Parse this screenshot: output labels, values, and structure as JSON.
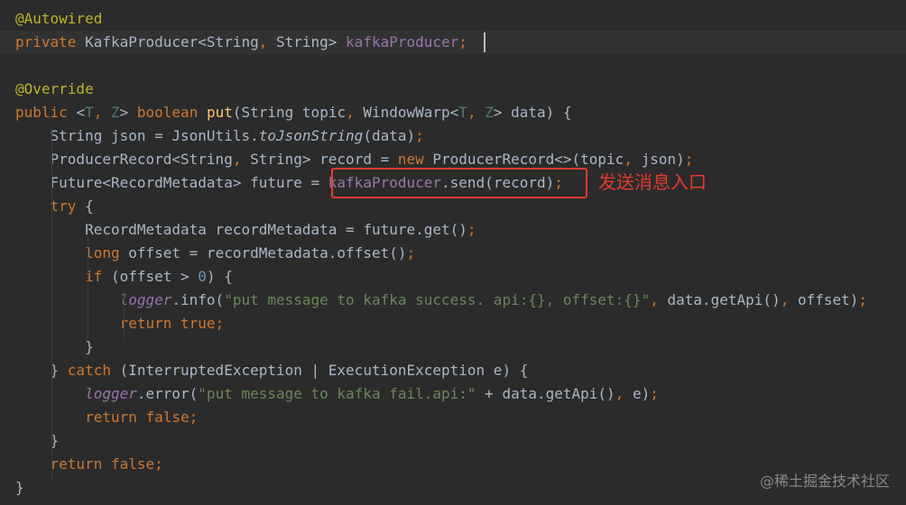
{
  "colors": {
    "background": "#2b2b2b",
    "current_line": "#323232",
    "default_text": "#a9b7c6",
    "keyword": "#cc7832",
    "annotation": "#bbb529",
    "field": "#9876aa",
    "method_declaration": "#ffc66d",
    "string": "#6a8759",
    "number": "#6897bb",
    "type_parameter": "#507874",
    "callout": "#e63b2e",
    "watermark": "#8a8a8a"
  },
  "code": {
    "lines": [
      {
        "tokens": [
          {
            "t": "@Autowired",
            "c": "annotation"
          }
        ]
      },
      {
        "current": true,
        "tokens": [
          {
            "t": "private ",
            "c": "keyword"
          },
          {
            "t": "KafkaProducer<String",
            "c": "default"
          },
          {
            "t": ", ",
            "c": "keyword"
          },
          {
            "t": "String> ",
            "c": "default"
          },
          {
            "t": "kafkaProducer",
            "c": "field"
          },
          {
            "t": ";",
            "c": "keyword"
          }
        ]
      },
      {
        "tokens": []
      },
      {
        "tokens": [
          {
            "t": "@Override",
            "c": "annotation"
          }
        ]
      },
      {
        "tokens": [
          {
            "t": "public ",
            "c": "keyword"
          },
          {
            "t": "<",
            "c": "default"
          },
          {
            "t": "T",
            "c": "typeparam"
          },
          {
            "t": ", ",
            "c": "keyword"
          },
          {
            "t": "Z",
            "c": "typeparam"
          },
          {
            "t": "> ",
            "c": "default"
          },
          {
            "t": "boolean ",
            "c": "keyword"
          },
          {
            "t": "put",
            "c": "method"
          },
          {
            "t": "(String topic",
            "c": "default"
          },
          {
            "t": ", ",
            "c": "keyword"
          },
          {
            "t": "WindowWarp<",
            "c": "default"
          },
          {
            "t": "T",
            "c": "typeparam"
          },
          {
            "t": ", ",
            "c": "keyword"
          },
          {
            "t": "Z",
            "c": "typeparam"
          },
          {
            "t": "> data) {",
            "c": "default"
          }
        ]
      },
      {
        "tokens": [
          {
            "t": "    String json = JsonUtils.",
            "c": "default"
          },
          {
            "t": "toJsonString",
            "c": "static"
          },
          {
            "t": "(data)",
            "c": "default"
          },
          {
            "t": ";",
            "c": "keyword"
          }
        ]
      },
      {
        "tokens": [
          {
            "t": "    ProducerRecord<String",
            "c": "default"
          },
          {
            "t": ", ",
            "c": "keyword"
          },
          {
            "t": "String> record = ",
            "c": "default"
          },
          {
            "t": "new ",
            "c": "keyword"
          },
          {
            "t": "ProducerRecord<>(topic",
            "c": "default"
          },
          {
            "t": ", ",
            "c": "keyword"
          },
          {
            "t": "json)",
            "c": "default"
          },
          {
            "t": ";",
            "c": "keyword"
          }
        ]
      },
      {
        "tokens": [
          {
            "t": "    Future<RecordMetadata> future = ",
            "c": "default"
          },
          {
            "t": "kafkaProducer",
            "c": "field"
          },
          {
            "t": ".send(record)",
            "c": "default"
          },
          {
            "t": ";",
            "c": "keyword"
          }
        ]
      },
      {
        "tokens": [
          {
            "t": "    ",
            "c": "default"
          },
          {
            "t": "try ",
            "c": "keyword"
          },
          {
            "t": "{",
            "c": "default"
          }
        ]
      },
      {
        "tokens": [
          {
            "t": "        RecordMetadata recordMetadata = future.get()",
            "c": "default"
          },
          {
            "t": ";",
            "c": "keyword"
          }
        ]
      },
      {
        "tokens": [
          {
            "t": "        ",
            "c": "default"
          },
          {
            "t": "long ",
            "c": "keyword"
          },
          {
            "t": "offset = recordMetadata.offset()",
            "c": "default"
          },
          {
            "t": ";",
            "c": "keyword"
          }
        ]
      },
      {
        "tokens": [
          {
            "t": "        ",
            "c": "default"
          },
          {
            "t": "if ",
            "c": "keyword"
          },
          {
            "t": "(offset > ",
            "c": "default"
          },
          {
            "t": "0",
            "c": "number"
          },
          {
            "t": ") {",
            "c": "default"
          }
        ]
      },
      {
        "tokens": [
          {
            "t": "            ",
            "c": "default"
          },
          {
            "t": "logger",
            "c": "staticfield"
          },
          {
            "t": ".info(",
            "c": "default"
          },
          {
            "t": "\"put message to kafka success. api:{}, offset:{}\"",
            "c": "string"
          },
          {
            "t": ", ",
            "c": "keyword"
          },
          {
            "t": "data.getApi()",
            "c": "default"
          },
          {
            "t": ", ",
            "c": "keyword"
          },
          {
            "t": "offset)",
            "c": "default"
          },
          {
            "t": ";",
            "c": "keyword"
          }
        ]
      },
      {
        "tokens": [
          {
            "t": "            ",
            "c": "default"
          },
          {
            "t": "return true;",
            "c": "keyword"
          }
        ]
      },
      {
        "tokens": [
          {
            "t": "        }",
            "c": "default"
          }
        ]
      },
      {
        "tokens": [
          {
            "t": "    } ",
            "c": "default"
          },
          {
            "t": "catch ",
            "c": "keyword"
          },
          {
            "t": "(InterruptedException | ExecutionException e) {",
            "c": "default"
          }
        ]
      },
      {
        "tokens": [
          {
            "t": "        ",
            "c": "default"
          },
          {
            "t": "logger",
            "c": "staticfield"
          },
          {
            "t": ".error(",
            "c": "default"
          },
          {
            "t": "\"put message to kafka fail.api:\"",
            "c": "string"
          },
          {
            "t": " + data.getApi()",
            "c": "default"
          },
          {
            "t": ", ",
            "c": "keyword"
          },
          {
            "t": "e)",
            "c": "default"
          },
          {
            "t": ";",
            "c": "keyword"
          }
        ]
      },
      {
        "tokens": [
          {
            "t": "        ",
            "c": "default"
          },
          {
            "t": "return false;",
            "c": "keyword"
          }
        ]
      },
      {
        "tokens": [
          {
            "t": "    }",
            "c": "default"
          }
        ]
      },
      {
        "tokens": [
          {
            "t": "    ",
            "c": "default"
          },
          {
            "t": "return false;",
            "c": "keyword"
          }
        ]
      },
      {
        "tokens": [
          {
            "t": "}",
            "c": "default"
          }
        ]
      }
    ]
  },
  "annotation": {
    "label": "发送消息入口"
  },
  "watermark": {
    "text": "@稀土掘金技术社区"
  }
}
